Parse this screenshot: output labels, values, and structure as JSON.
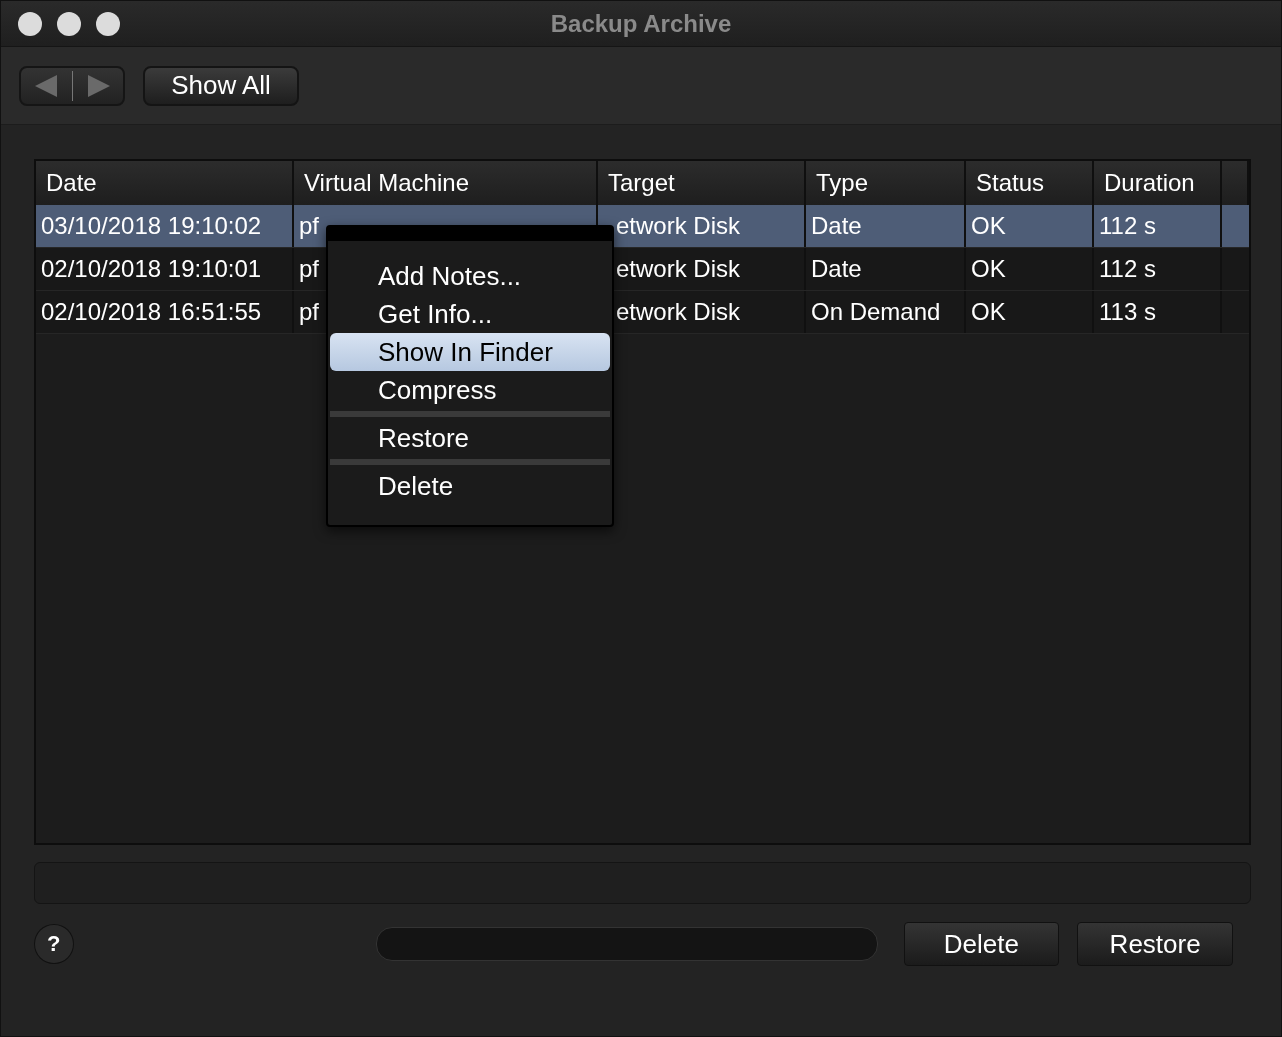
{
  "window": {
    "title": "Backup Archive"
  },
  "toolbar": {
    "show_all": "Show All"
  },
  "table": {
    "columns": [
      "Date",
      "Virtual Machine",
      "Target",
      "Type",
      "Status",
      "Duration"
    ],
    "rows": [
      {
        "selected": true,
        "cells": [
          "03/10/2018 19:10:02",
          "pf",
          "etwork Disk",
          "Date",
          "OK",
          "112 s"
        ]
      },
      {
        "selected": false,
        "cells": [
          "02/10/2018 19:10:01",
          "pf",
          "etwork Disk",
          "Date",
          "OK",
          "112 s"
        ]
      },
      {
        "selected": false,
        "cells": [
          "02/10/2018 16:51:55",
          "pf",
          "etwork Disk",
          "On Demand",
          "OK",
          "113 s"
        ]
      }
    ]
  },
  "context_menu": {
    "items": [
      {
        "kind": "item",
        "label": "Add Notes...",
        "selected": false
      },
      {
        "kind": "item",
        "label": "Get Info...",
        "selected": false
      },
      {
        "kind": "item",
        "label": "Show In Finder",
        "selected": true
      },
      {
        "kind": "item",
        "label": "Compress",
        "selected": false
      },
      {
        "kind": "separator"
      },
      {
        "kind": "item",
        "label": "Restore",
        "selected": false
      },
      {
        "kind": "separator"
      },
      {
        "kind": "item",
        "label": "Delete",
        "selected": false
      }
    ]
  },
  "footer": {
    "help": "?",
    "buttons": [
      "Delete",
      "Restore"
    ]
  }
}
